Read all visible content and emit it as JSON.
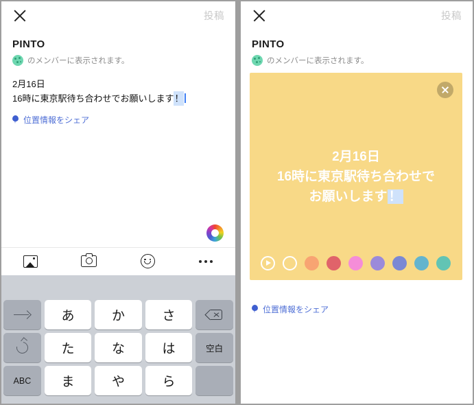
{
  "meta": {
    "app": "LINE group post composer",
    "accent_blue": "#4f6fd6",
    "card_yellow": "#f8d987",
    "ime_highlight": "#cfe2fb"
  },
  "topbar": {
    "close_label": "close",
    "post_label": "投稿"
  },
  "group": {
    "name": "PINTO",
    "visibility_text": "のメンバーに表示されます。",
    "avatar_color": "#6ed7b0"
  },
  "composer": {
    "line1": "2月16日",
    "line2": "16時に東京駅待ち合わせでお願いします",
    "ime_char": "！"
  },
  "location": {
    "label": "位置情報をシェア"
  },
  "toolbar": {
    "items": [
      {
        "icon": "photo-icon",
        "label": "写真"
      },
      {
        "icon": "camera-icon",
        "label": "カメラ"
      },
      {
        "icon": "smiley-icon",
        "label": "スタンプ"
      },
      {
        "icon": "more-icon",
        "label": "その他"
      }
    ],
    "color_wheel_label": "カラー"
  },
  "keyboard": {
    "candidate_bar": "",
    "rows": [
      [
        {
          "label": "→",
          "type": "gray",
          "icon": "arrow-right-icon"
        },
        {
          "label": "あ",
          "type": "white"
        },
        {
          "label": "か",
          "type": "white"
        },
        {
          "label": "さ",
          "type": "white"
        },
        {
          "label": "",
          "type": "gray",
          "icon": "backspace-icon"
        }
      ],
      [
        {
          "label": "",
          "type": "gray",
          "icon": "undo-icon"
        },
        {
          "label": "た",
          "type": "white"
        },
        {
          "label": "な",
          "type": "white"
        },
        {
          "label": "は",
          "type": "white"
        },
        {
          "label": "空白",
          "type": "gray",
          "small": true
        }
      ],
      [
        {
          "label": "ABC",
          "type": "gray",
          "small": true
        },
        {
          "label": "ま",
          "type": "white"
        },
        {
          "label": "や",
          "type": "white"
        },
        {
          "label": "ら",
          "type": "white"
        },
        {
          "label": "",
          "type": "gray"
        }
      ]
    ]
  },
  "card": {
    "close_label": "close",
    "text_line1": "2月16日",
    "text_line2": "16時に東京駅待ち合わせで",
    "text_line3": "お願いします",
    "text_ime_char": "！",
    "swatches": [
      {
        "name": "animate-toggle",
        "kind": "play",
        "color": "#ffffff"
      },
      {
        "name": "no-color",
        "kind": "ring",
        "color": "#ffffff"
      },
      {
        "name": "swatch-orange",
        "kind": "solid",
        "color": "#f8a472"
      },
      {
        "name": "swatch-red",
        "kind": "solid",
        "color": "#e0636a"
      },
      {
        "name": "swatch-pink",
        "kind": "solid",
        "color": "#f58dd8"
      },
      {
        "name": "swatch-purple",
        "kind": "solid",
        "color": "#9b8ada"
      },
      {
        "name": "swatch-indigo",
        "kind": "solid",
        "color": "#7b88d4"
      },
      {
        "name": "swatch-blue",
        "kind": "solid",
        "color": "#64b4ce"
      },
      {
        "name": "swatch-teal",
        "kind": "solid",
        "color": "#62c4b4"
      }
    ]
  }
}
